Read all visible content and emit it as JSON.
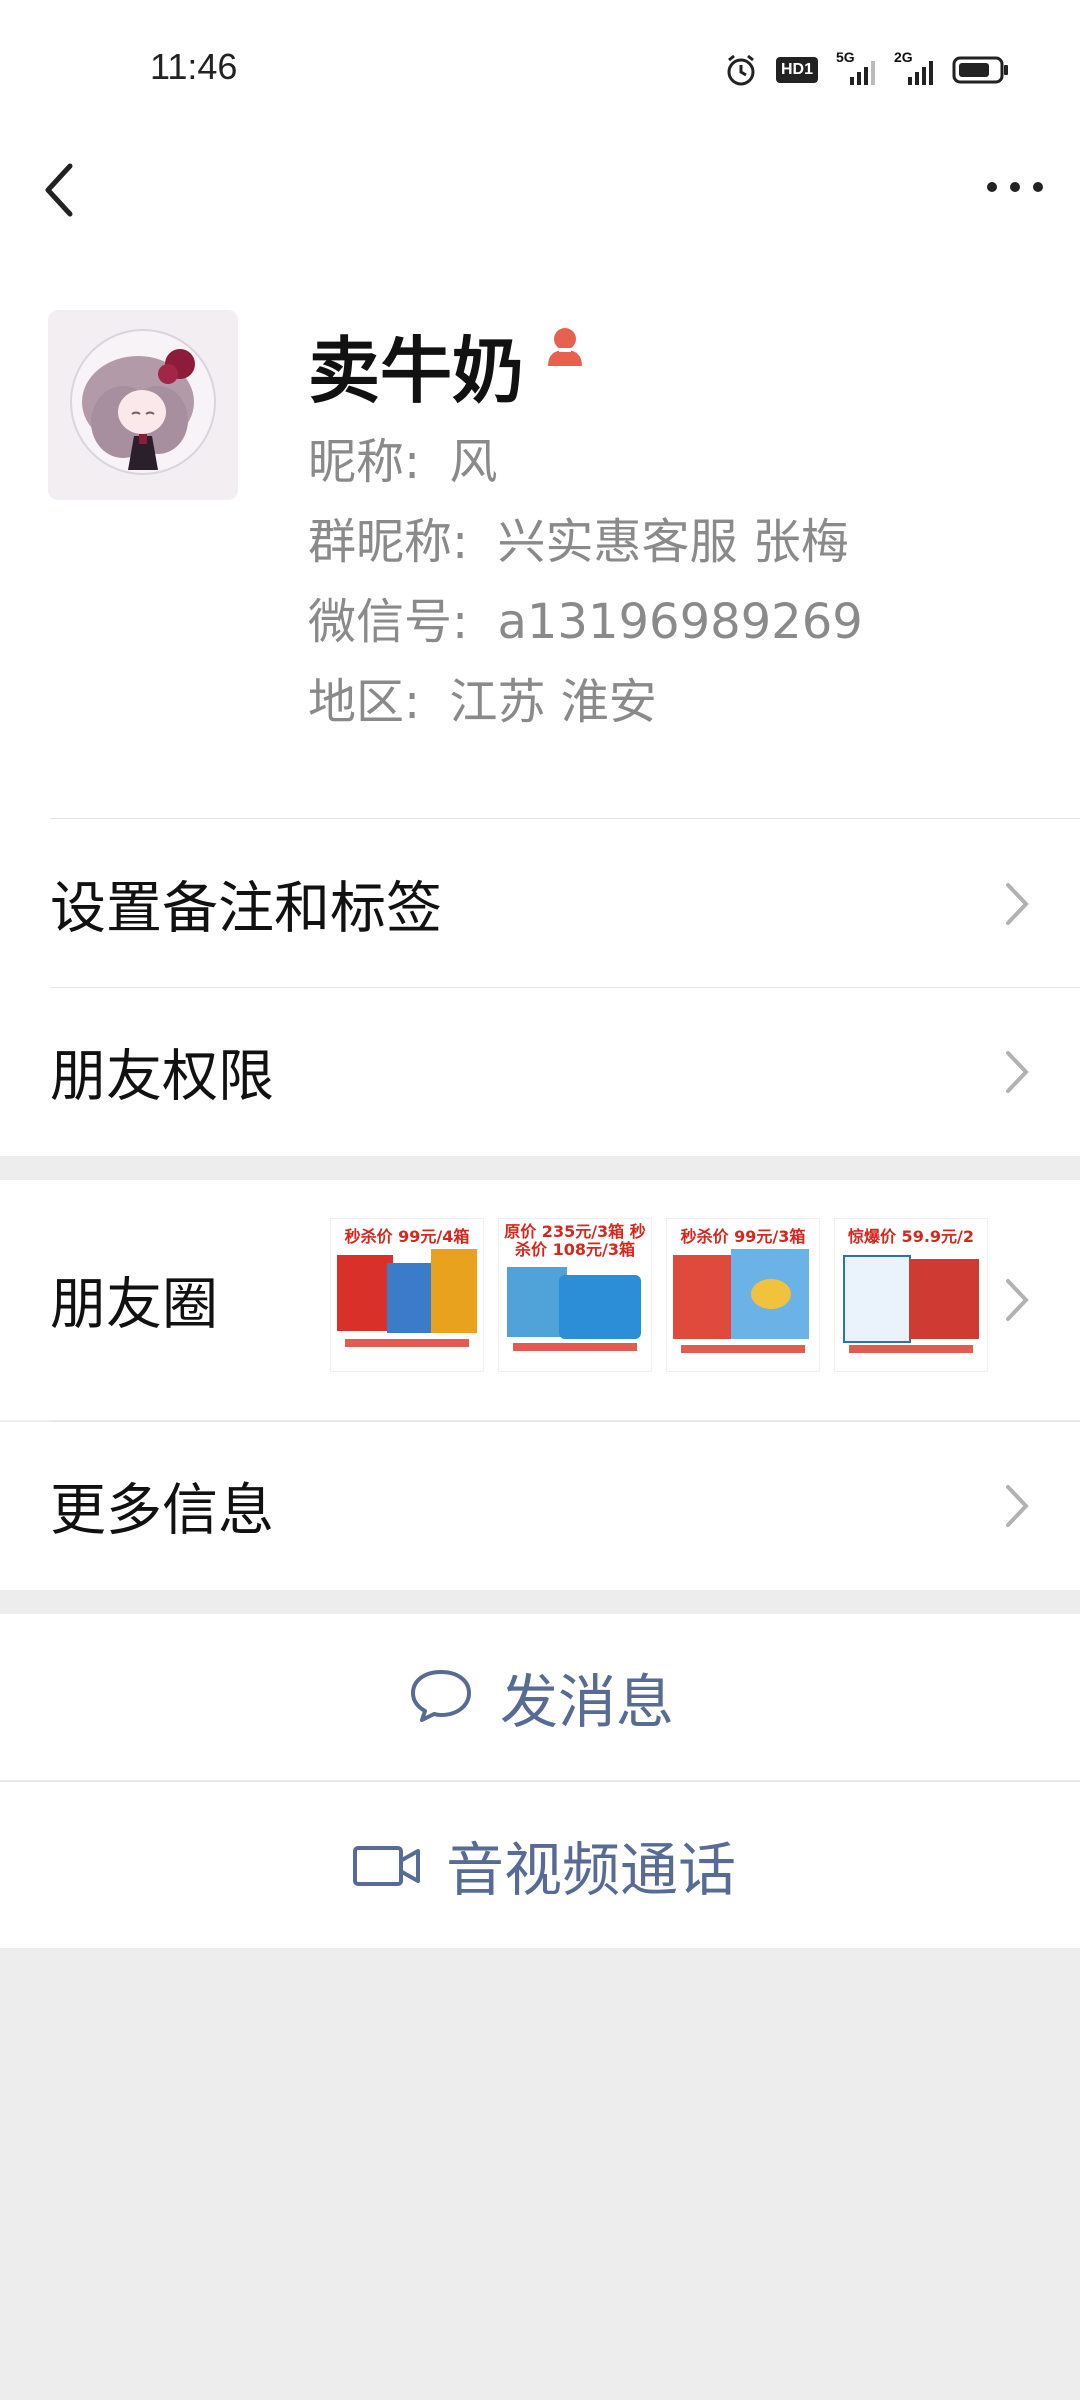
{
  "status": {
    "time": "11:46",
    "icons": [
      "alarm-icon",
      "hd-icon",
      "5g-signal-icon",
      "2g-signal-icon",
      "battery-icon"
    ],
    "hd_label": "HD1",
    "net1_label": "5G",
    "net2_label": "2G"
  },
  "profile": {
    "name": "卖牛奶",
    "nickname_label": "昵称:",
    "nickname": "风",
    "group_nick_label": "群昵称:",
    "group_nick": "兴实惠客服 张梅",
    "wechat_id_label": "微信号:",
    "wechat_id": "a13196989269",
    "region_label": "地区:",
    "region": "江苏 淮安"
  },
  "menu": {
    "remark": "设置备注和标签",
    "permission": "朋友权限",
    "moments": "朋友圈",
    "more_info": "更多信息"
  },
  "moments_thumbs": [
    {
      "price_text": "秒杀价 99元/4箱"
    },
    {
      "price_text": "原价 235元/3箱 秒杀价 108元/3箱"
    },
    {
      "price_text": "秒杀价 99元/3箱"
    },
    {
      "price_text": "惊爆价 59.9元/2"
    }
  ],
  "actions": {
    "message": "发消息",
    "call": "音视频通话"
  },
  "colors": {
    "link": "#576b95",
    "divider": "#e4e4e4",
    "background": "#ededed",
    "gender_female": "#e8614f"
  }
}
